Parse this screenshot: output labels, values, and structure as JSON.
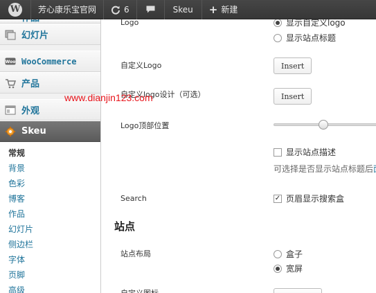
{
  "admin_bar": {
    "site_name": "芳心康乐宝官网",
    "updates_count": "6",
    "theme": "Skeu",
    "new_label": "新建"
  },
  "menu": {
    "items": [
      {
        "label": "作品"
      },
      {
        "label": "幻灯片"
      },
      {
        "label": "WooCommerce"
      },
      {
        "label": "产品"
      },
      {
        "label": "外观"
      },
      {
        "label": "Skeu"
      }
    ],
    "submenu": [
      "常规",
      "背景",
      "色彩",
      "博客",
      "作品",
      "幻灯片",
      "侧边栏",
      "字体",
      "页脚",
      "高级"
    ]
  },
  "watermark": "www.dianjin123.com",
  "settings": {
    "logo_label": "Logo",
    "logo_option_custom": "显示自定义logo",
    "logo_option_title": "显示站点标题",
    "custom_logo_label": "自定义Logo",
    "custom_logo_button": "Insert",
    "custom_logo_design_label": "自定义logo设计（可选）",
    "custom_logo_design_button": "Insert",
    "logo_top_position_label": "Logo顶部位置",
    "logo_top_position_value": 0.47,
    "show_description_label": "显示站点描述",
    "show_description_checked": false,
    "description_help": "可选择是否显示站点标题后",
    "description_help_link": "面",
    "search_label": "Search",
    "search_option": "页眉显示搜索盒",
    "search_checked": true,
    "site_section_title": "站点",
    "site_layout_label": "站点布局",
    "layout_boxed": "盒子",
    "layout_wide": "宽屏",
    "custom_icon_label": "自定义图标"
  }
}
